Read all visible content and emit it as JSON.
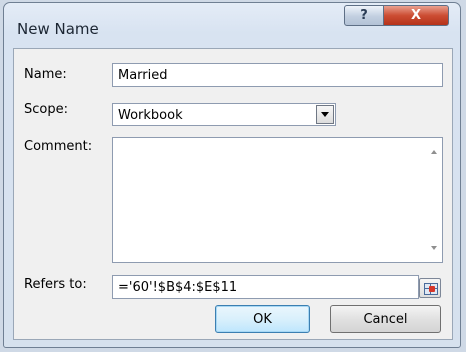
{
  "window": {
    "title": "New Name",
    "help_glyph": "?",
    "close_glyph": "X"
  },
  "form": {
    "name_label": "Name:",
    "name_value": "Married",
    "scope_label": "Scope:",
    "scope_value": "Workbook",
    "comment_label": "Comment:",
    "comment_value": "",
    "refers_label": "Refers to:",
    "refers_value": "='60'!$B$4:$E$11"
  },
  "buttons": {
    "ok_label": "OK",
    "cancel_label": "Cancel"
  },
  "icons": {
    "help": "help-icon",
    "close": "close-icon",
    "dropdown": "chevron-down-icon",
    "collapse": "range-select-icon"
  }
}
